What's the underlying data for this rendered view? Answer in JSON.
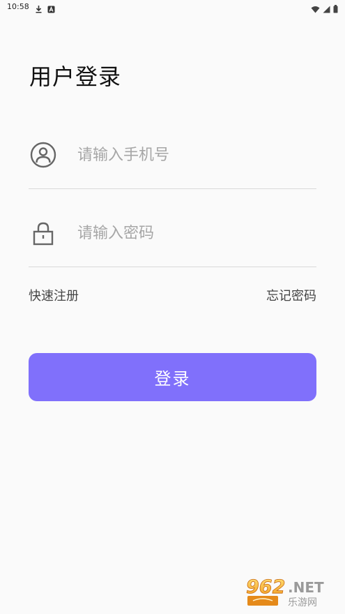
{
  "status_bar": {
    "time": "10:58",
    "left_icons": [
      "download-icon",
      "notification-a-icon"
    ],
    "right_icons": [
      "wifi-icon",
      "signal-icon",
      "battery-icon"
    ]
  },
  "header": {
    "title": "用户登录"
  },
  "form": {
    "phone": {
      "icon": "user-circle-icon",
      "value": "",
      "placeholder": "请输入手机号"
    },
    "password": {
      "icon": "lock-icon",
      "value": "",
      "placeholder": "请输入密码"
    }
  },
  "links": {
    "register": "快速注册",
    "forgot_password": "忘记密码"
  },
  "login_button": {
    "label": "登录",
    "color": "#8070fb"
  },
  "watermark": {
    "logo_text": "962.NET",
    "subtitle": "乐游网"
  },
  "colors": {
    "background": "#fafafa",
    "accent": "#8070fb",
    "placeholder": "#a6a6a6",
    "divider": "#d9d9d9"
  }
}
